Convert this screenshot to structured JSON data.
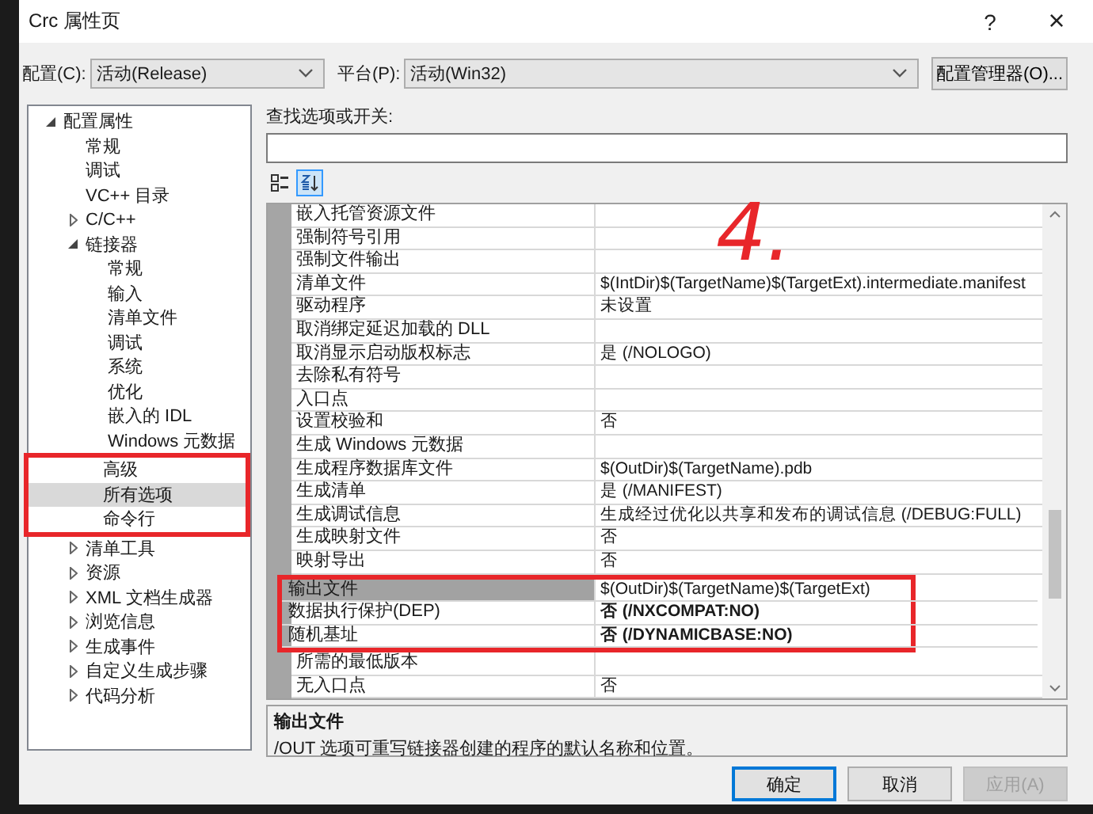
{
  "window": {
    "title": "Crc 属性页",
    "help": "?",
    "close": "×"
  },
  "config_bar": {
    "config_label": "配置(C):",
    "config_value": "活动(Release)",
    "platform_label": "平台(P):",
    "platform_value": "活动(Win32)",
    "manager_button": "配置管理器(O)..."
  },
  "tree": [
    {
      "label": "配置属性",
      "expanded": true,
      "selected": false,
      "children": [
        {
          "label": "常规",
          "selected": false
        },
        {
          "label": "调试",
          "selected": false
        },
        {
          "label": "VC++ 目录",
          "selected": false
        },
        {
          "label": "C/C++",
          "expanded": false,
          "selected": false
        },
        {
          "label": "链接器",
          "expanded": true,
          "selected": false,
          "children": [
            {
              "label": "常规",
              "selected": false,
              "circled": false
            },
            {
              "label": "输入",
              "selected": false,
              "circled": false
            },
            {
              "label": "清单文件",
              "selected": false,
              "circled": false
            },
            {
              "label": "调试",
              "selected": false,
              "circled": false
            },
            {
              "label": "系统",
              "selected": false,
              "circled": false
            },
            {
              "label": "优化",
              "selected": false,
              "circled": false
            },
            {
              "label": "嵌入的 IDL",
              "selected": false,
              "circled": false
            },
            {
              "label": "Windows 元数据",
              "selected": false,
              "circled": false
            },
            {
              "label": "高级",
              "selected": false,
              "circled": true
            },
            {
              "label": "所有选项",
              "selected": true,
              "circled": true
            },
            {
              "label": "命令行",
              "selected": false,
              "circled": true
            }
          ]
        },
        {
          "label": "清单工具",
          "expanded": false,
          "selected": false
        },
        {
          "label": "资源",
          "expanded": false,
          "selected": false
        },
        {
          "label": "XML 文档生成器",
          "expanded": false,
          "selected": false
        },
        {
          "label": "浏览信息",
          "expanded": false,
          "selected": false
        },
        {
          "label": "生成事件",
          "expanded": false,
          "selected": false
        },
        {
          "label": "自定义生成步骤",
          "expanded": false,
          "selected": false
        },
        {
          "label": "代码分析",
          "expanded": false,
          "selected": false
        }
      ]
    }
  ],
  "search": {
    "label": "查找选项或开关:"
  },
  "view_buttons": [
    {
      "kind": "categorized",
      "selected": false
    },
    {
      "kind": "alphabetical",
      "selected": true
    }
  ],
  "grid": {
    "rows": [
      {
        "name": "嵌入托管资源文件",
        "value": "",
        "selected": false,
        "circled": false
      },
      {
        "name": "强制符号引用",
        "value": "",
        "selected": false,
        "circled": false
      },
      {
        "name": "强制文件输出",
        "value": "",
        "selected": false,
        "circled": false
      },
      {
        "name": "清单文件",
        "value": "$(IntDir)$(TargetName)$(TargetExt).intermediate.manifest",
        "bold": false,
        "selected": false,
        "circled": false
      },
      {
        "name": "驱动程序",
        "value": "未设置",
        "bold": false,
        "selected": false,
        "circled": false
      },
      {
        "name": "取消绑定延迟加载的 DLL",
        "value": "",
        "selected": false,
        "circled": false
      },
      {
        "name": "取消显示启动版权标志",
        "value": "是 (/NOLOGO)",
        "bold": false,
        "selected": false,
        "circled": false
      },
      {
        "name": "去除私有符号",
        "value": "",
        "selected": false,
        "circled": false
      },
      {
        "name": "入口点",
        "value": "",
        "selected": false,
        "circled": false
      },
      {
        "name": "设置校验和",
        "value": "否",
        "bold": false,
        "selected": false,
        "circled": false
      },
      {
        "name": "生成 Windows 元数据",
        "value": "",
        "selected": false,
        "circled": false
      },
      {
        "name": "生成程序数据库文件",
        "value": "$(OutDir)$(TargetName).pdb",
        "bold": false,
        "selected": false,
        "circled": false
      },
      {
        "name": "生成清单",
        "value": "是 (/MANIFEST)",
        "bold": false,
        "selected": false,
        "circled": false
      },
      {
        "name": "生成调试信息",
        "value": "生成经过优化以共享和发布的调试信息 (/DEBUG:FULL)",
        "bold": false,
        "selected": false,
        "circled": false
      },
      {
        "name": "生成映射文件",
        "value": "否",
        "bold": false,
        "selected": false,
        "circled": false
      },
      {
        "name": "映射导出",
        "value": "否",
        "bold": false,
        "selected": false,
        "circled": false
      },
      {
        "name": "输出文件",
        "value": "$(OutDir)$(TargetName)$(TargetExt)",
        "bold": false,
        "selected": true,
        "circled": true
      },
      {
        "name": "数据执行保护(DEP)",
        "value": "否 (/NXCOMPAT:NO)",
        "bold": true,
        "selected": false,
        "circled": true
      },
      {
        "name": "随机基址",
        "value": "否 (/DYNAMICBASE:NO)",
        "bold": true,
        "selected": false,
        "circled": true
      },
      {
        "name": "所需的最低版本",
        "value": "",
        "selected": false,
        "circled": false
      },
      {
        "name": "无入口点",
        "value": "否",
        "bold": false,
        "selected": false,
        "circled": false
      }
    ]
  },
  "description": {
    "title": "输出文件",
    "text": "/OUT 选项可重写链接器创建的程序的默认名称和位置。"
  },
  "buttons": [
    {
      "label": "确定",
      "default": true,
      "disabled": false
    },
    {
      "label": "取消",
      "default": false,
      "disabled": false
    },
    {
      "label": "应用(A)",
      "default": false,
      "disabled": true
    }
  ],
  "annotations": [
    {
      "kind": "note",
      "text": "4."
    }
  ]
}
